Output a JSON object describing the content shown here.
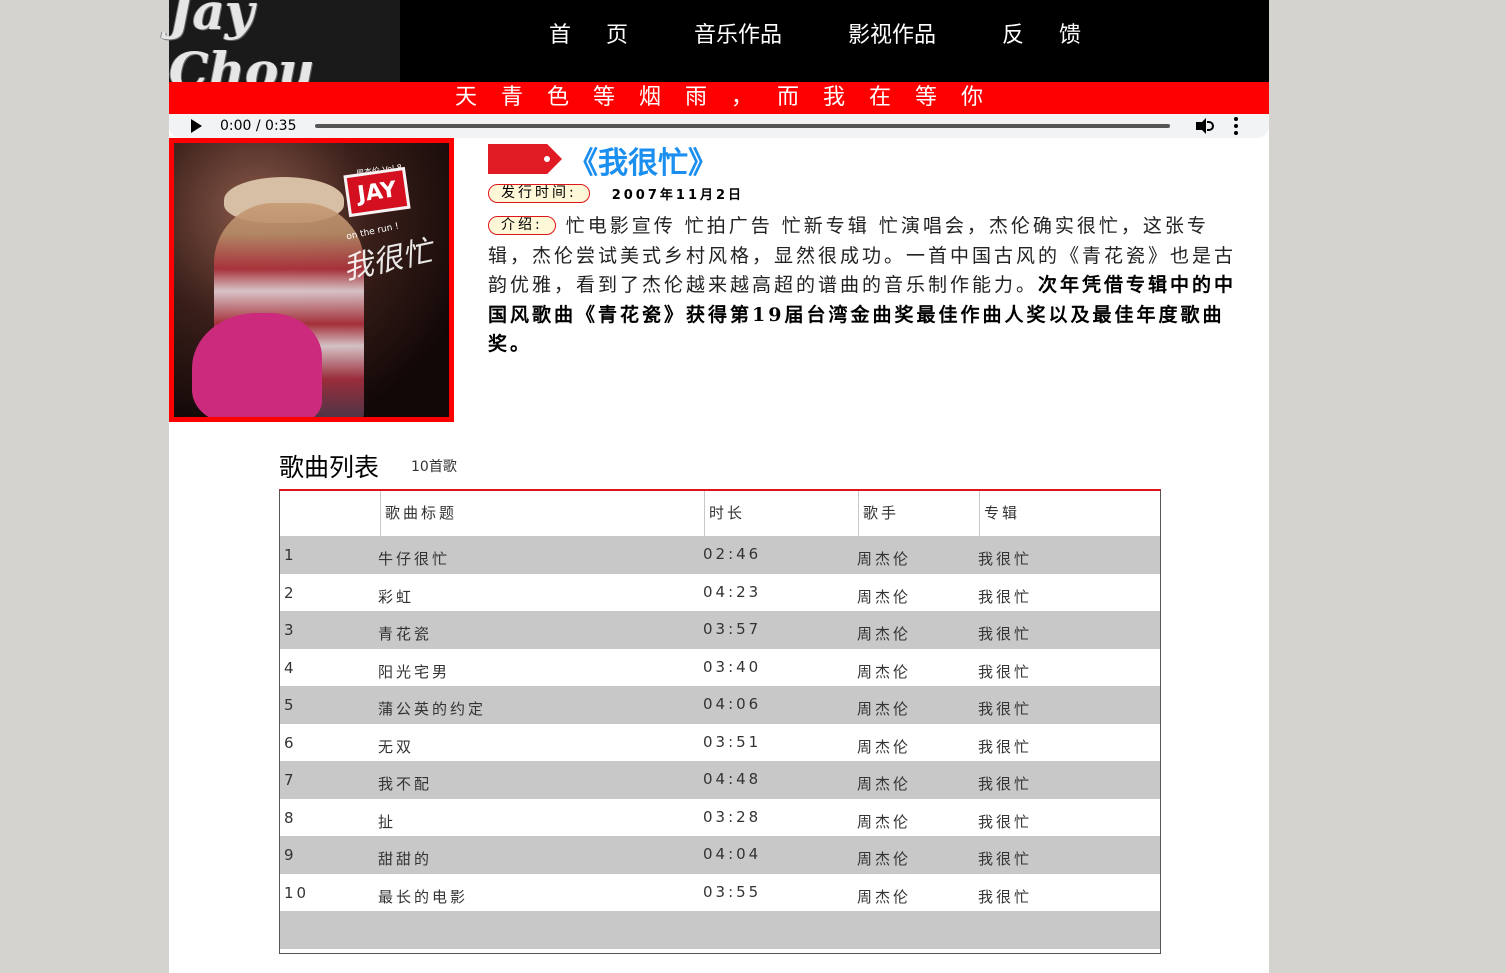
{
  "header": {
    "logo_text": "Jay Chou",
    "nav": [
      {
        "label": "首 页"
      },
      {
        "label": "音乐作品"
      },
      {
        "label": "影视作品"
      },
      {
        "label": "反 馈"
      }
    ]
  },
  "banner": {
    "text": "天青色等烟雨，而我在等你"
  },
  "audio": {
    "time": "0:00 / 0:35",
    "progress": 0
  },
  "album": {
    "cover_badge": "JAY",
    "cover_small": "周杰伦 Vol.8",
    "cover_tagline": "on the run !",
    "cover_script": "我很忙",
    "title": "《我很忙》",
    "release_label": "发行时间:",
    "release_date": "2007年11月2日",
    "intro_label": "介绍:",
    "intro_text": "忙电影宣传 忙拍广告 忙新专辑 忙演唱会，杰伦确实很忙，这张专辑，杰伦尝试美式乡村风格，显然很成功。一首中国古风的《青花瓷》也是古韵优雅，看到了杰伦越来越高超的谱曲的音乐制作能力。",
    "intro_bold": "次年凭借专辑中的中国风歌曲《青花瓷》获得第19届台湾金曲奖最佳作曲人奖以及最佳年度歌曲奖。"
  },
  "song_list": {
    "title": "歌曲列表",
    "count": "10首歌",
    "headers": [
      "",
      "歌曲标题",
      "时长",
      "歌手",
      "专辑"
    ],
    "songs": [
      {
        "num": "1",
        "title": "牛仔很忙",
        "duration": "02:46",
        "artist": "周杰伦",
        "album": "我很忙"
      },
      {
        "num": "2",
        "title": "彩虹",
        "duration": "04:23",
        "artist": "周杰伦",
        "album": "我很忙"
      },
      {
        "num": "3",
        "title": "青花瓷",
        "duration": "03:57",
        "artist": "周杰伦",
        "album": "我很忙"
      },
      {
        "num": "4",
        "title": "阳光宅男",
        "duration": "03:40",
        "artist": "周杰伦",
        "album": "我很忙"
      },
      {
        "num": "5",
        "title": "蒲公英的约定",
        "duration": "04:06",
        "artist": "周杰伦",
        "album": "我很忙"
      },
      {
        "num": "6",
        "title": "无双",
        "duration": "03:51",
        "artist": "周杰伦",
        "album": "我很忙"
      },
      {
        "num": "7",
        "title": "我不配",
        "duration": "04:48",
        "artist": "周杰伦",
        "album": "我很忙"
      },
      {
        "num": "8",
        "title": "扯",
        "duration": "03:28",
        "artist": "周杰伦",
        "album": "我很忙"
      },
      {
        "num": "9",
        "title": "甜甜的",
        "duration": "04:04",
        "artist": "周杰伦",
        "album": "我很忙"
      },
      {
        "num": "10",
        "title": "最长的电影",
        "duration": "03:55",
        "artist": "周杰伦",
        "album": "我很忙"
      }
    ]
  },
  "colors": {
    "accent": "#ff0000",
    "title_blue": "#1a8ff0",
    "row_alt": "#c8c8c8"
  }
}
